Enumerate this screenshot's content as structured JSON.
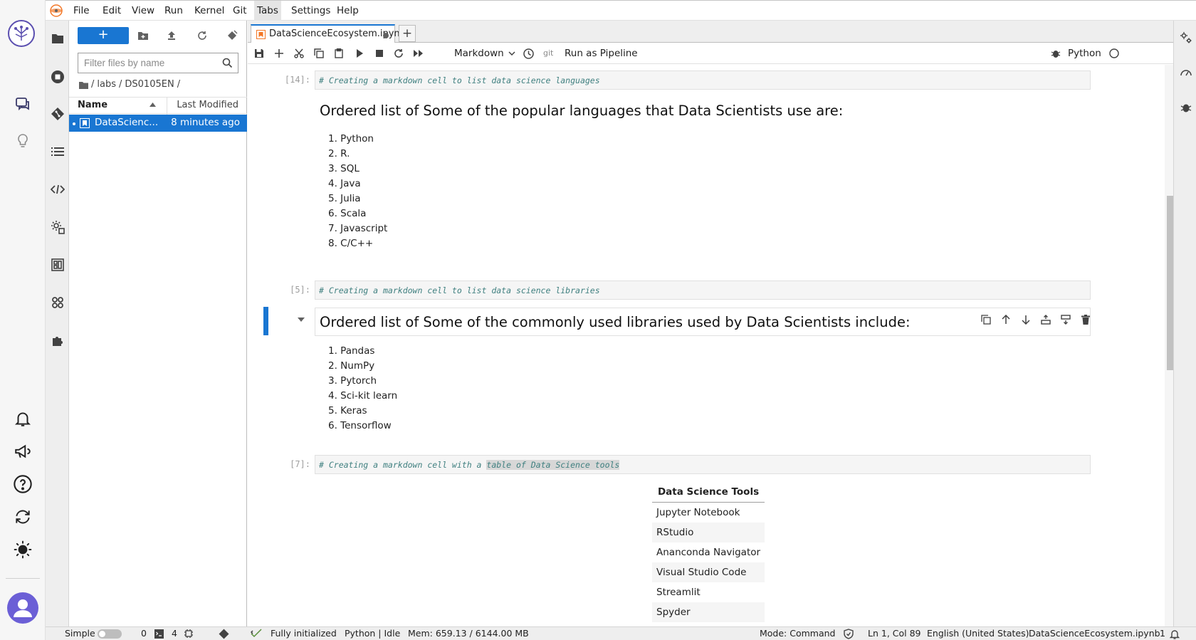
{
  "menubar": {
    "items": [
      "File",
      "Edit",
      "View",
      "Run",
      "Kernel",
      "Git",
      "Tabs",
      "Settings",
      "Help"
    ],
    "active": "Tabs"
  },
  "filebrowser": {
    "new_label": "+",
    "filter_placeholder": "Filter files by name",
    "breadcrumbs": [
      "labs",
      "DS0105EN"
    ],
    "columns": {
      "name": "Name",
      "modified": "Last Modified"
    },
    "files": [
      {
        "name": "DataScienc...",
        "modified": "8 minutes ago"
      }
    ]
  },
  "tab": {
    "label": "DataScienceEcosystem.ipyn",
    "add_label": "+"
  },
  "toolbar": {
    "cell_type": "Markdown",
    "git_label": "git",
    "pipeline_label": "Run as Pipeline",
    "kernel_name": "Python"
  },
  "notebook": {
    "cells": [
      {
        "prompt": "[14]:",
        "source": "# Creating a markdown cell to list data science languages"
      },
      {
        "heading": "Ordered list of Some of the popular languages that Data Scientists use are:",
        "items": [
          "1. Python",
          "2. R.",
          "3. SQL",
          "4. Java",
          "5. Julia",
          "6. Scala",
          "7. Javascript",
          "8. C/C++"
        ]
      },
      {
        "prompt": "[5]:",
        "source": "# Creating a markdown cell to list data science libraries"
      },
      {
        "heading": "Ordered list of Some of the commonly used libraries used by Data Scientists include:",
        "items": [
          "1. Pandas",
          "2. NumPy",
          "3. Pytorch",
          "4. Sci-kit learn",
          "5. Keras",
          "6. Tensorflow"
        ]
      },
      {
        "prompt": "[7]:",
        "source_prefix": "# Creating a markdown cell with a ",
        "source_highlight": "table of Data Science tools"
      },
      {
        "table_header": "Data Science Tools",
        "rows": [
          "Jupyter Notebook",
          "RStudio",
          "Ananconda Navigator",
          "Visual Studio Code",
          "Streamlit",
          "Spyder"
        ]
      }
    ]
  },
  "statusbar": {
    "mode_label": "Simple",
    "terminals": "0",
    "kernels": "4",
    "status": "Fully initialized",
    "kernel": "Python | Idle",
    "mem": "Mem: 659.13 / 6144.00 MB",
    "mode": "Mode: Command",
    "cursor": "Ln 1, Col 89",
    "language": "English (United States)",
    "filename": "DataScienceEcosystem.ipynb",
    "count": "1"
  },
  "colors": {
    "accent": "#1976d2",
    "comment": "#408080"
  }
}
